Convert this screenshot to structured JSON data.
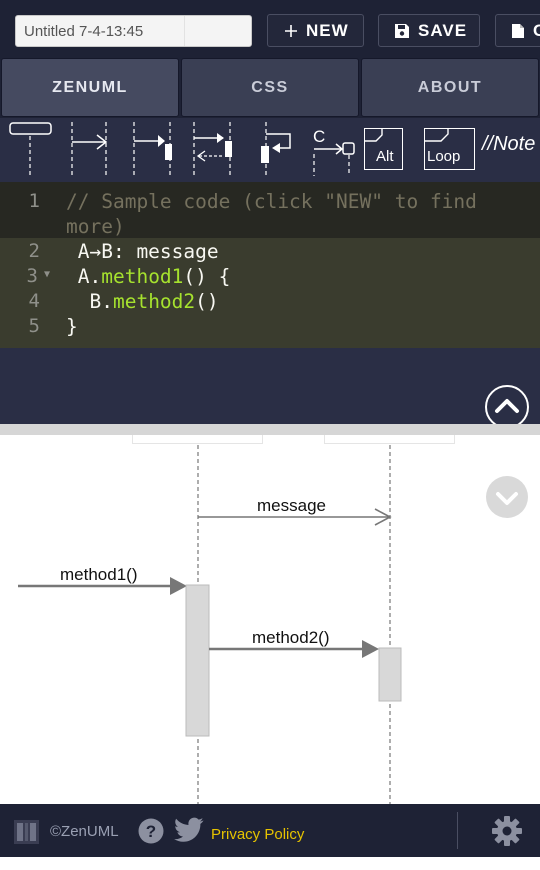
{
  "header": {
    "title_value": "Untitled 7-4-13:45",
    "new_label": "NEW",
    "save_label": "SAVE",
    "copy_label": "C"
  },
  "tabs": [
    {
      "label": "ZENUML",
      "active": true
    },
    {
      "label": "CSS",
      "active": false
    },
    {
      "label": "ABOUT",
      "active": false
    }
  ],
  "toolbar": {
    "alt_label": "Alt",
    "loop_label": "Loop",
    "note_label": "//Note",
    "creation_label": "C"
  },
  "editor": {
    "lines": [
      {
        "number": "1",
        "text": "// Sample code (click \"NEW\" to find",
        "text_cont": "more)"
      },
      {
        "number": "2",
        "text": " A→B: message"
      },
      {
        "number": "3",
        "obj": " A.",
        "method": "method1",
        "rest": "() {"
      },
      {
        "number": "4",
        "obj": "  B.",
        "method": "method2",
        "rest": "()"
      },
      {
        "number": "5",
        "text": "}"
      }
    ]
  },
  "diagram": {
    "messages": [
      "message",
      "method1()",
      "method2()"
    ]
  },
  "footer": {
    "copyright": "©ZenUML",
    "privacy": "Privacy Policy"
  },
  "colors": {
    "dark_bg": "#1e2235",
    "panel_bg": "#2a2e45",
    "tab_bg": "#3a3f54",
    "editor_bg": "#272822",
    "comment": "#75715e",
    "method": "#a6e22e",
    "privacy_link": "#e6c300"
  }
}
